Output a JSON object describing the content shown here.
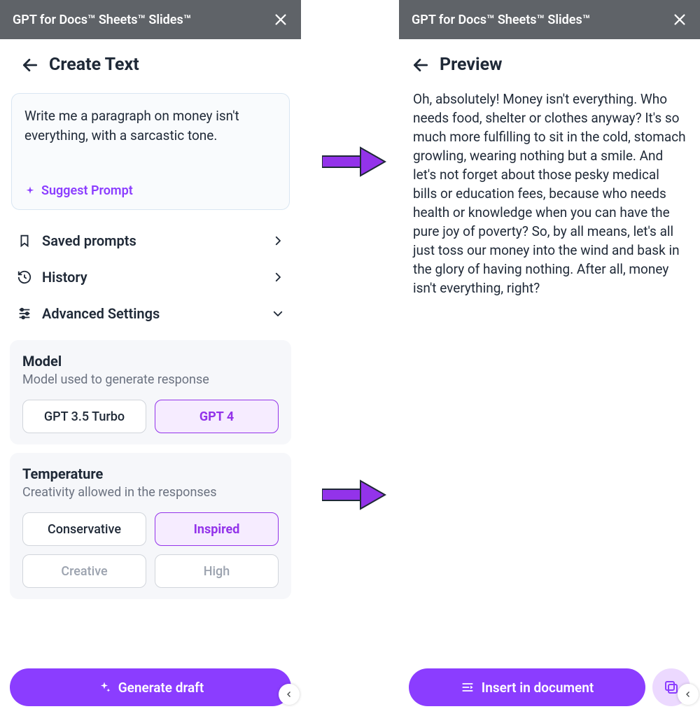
{
  "titlebar": "GPT for Docs™ Sheets™ Slides™",
  "left": {
    "header": "Create Text",
    "prompt": "Write me a paragraph on money isn't everything, with a sarcastic tone.",
    "suggest": "Suggest Prompt",
    "rows": {
      "saved": "Saved prompts",
      "history": "History",
      "advanced": "Advanced Settings"
    },
    "model": {
      "title": "Model",
      "sub": "Model used to generate response",
      "opt1": "GPT 3.5 Turbo",
      "opt2": "GPT 4"
    },
    "temperature": {
      "title": "Temperature",
      "sub": "Creativity allowed in the responses",
      "opt1": "Conservative",
      "opt2": "Inspired",
      "opt3": "Creative",
      "opt4": "High"
    },
    "cta": "Generate draft"
  },
  "right": {
    "header": "Preview",
    "body": "Oh, absolutely! Money isn't everything. Who needs food, shelter or clothes anyway? It's so much more fulfilling to sit in the cold, stomach growling, wearing nothing but a smile. And let's not forget about those pesky medical bills or education fees, because who needs health or knowledge when you can have the pure joy of poverty? So, by all means, let's all just toss our money into the wind and bask in the glory of having nothing. After all, money isn't everything, right?",
    "cta": "Insert in document"
  }
}
